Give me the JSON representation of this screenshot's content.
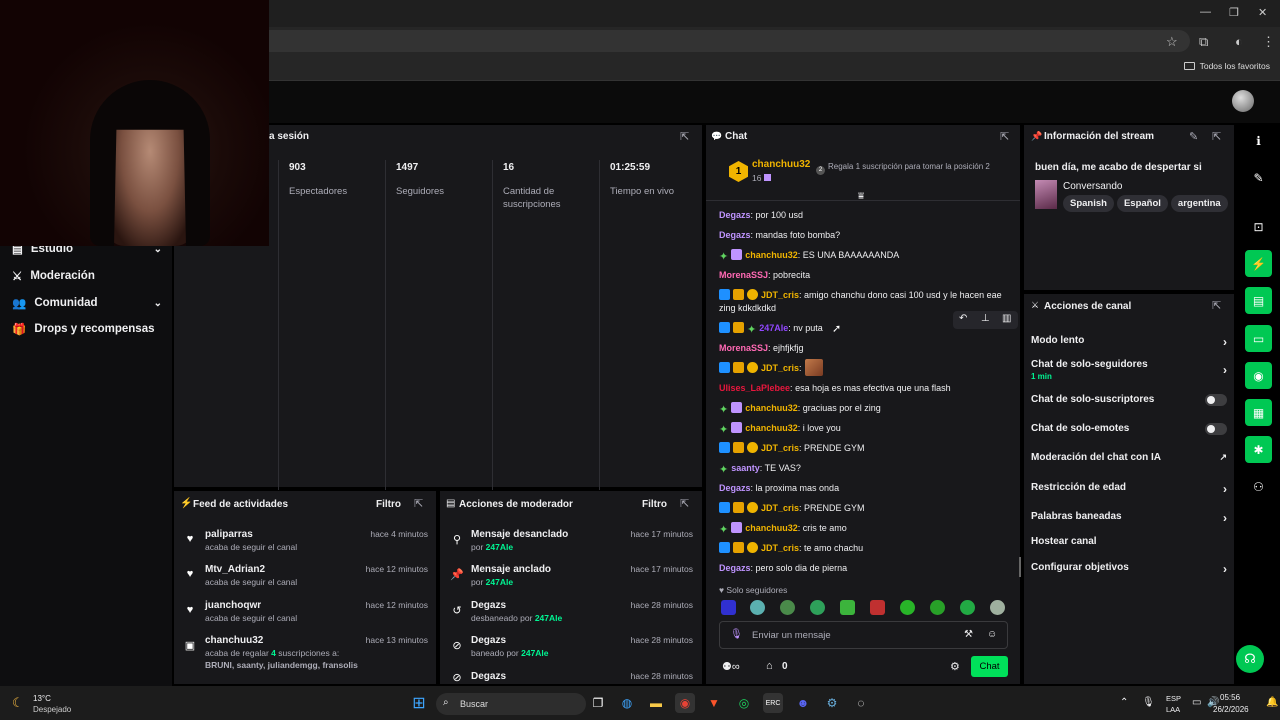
{
  "browser": {
    "favorites_label": "Todos los favoritos"
  },
  "sidebar": {
    "items": [
      {
        "label": "Estudio",
        "icon": "studio-icon",
        "chevron": true
      },
      {
        "label": "Moderación",
        "icon": "sword-icon",
        "chevron": false
      },
      {
        "label": "Comunidad",
        "icon": "people-icon",
        "chevron": true
      },
      {
        "label": "Drops y recompensas",
        "icon": "gift-icon",
        "chevron": false
      }
    ]
  },
  "session": {
    "title_visible": "a sesión",
    "stats": [
      {
        "value": "903",
        "label": "Espectadores"
      },
      {
        "value": "1497",
        "label": "Seguidores"
      },
      {
        "value": "16",
        "label": "Cantidad de suscripciones"
      },
      {
        "value": "01:25:59",
        "label": "Tiempo en vivo"
      }
    ]
  },
  "activity": {
    "title": "Feed de actividades",
    "filter_label": "Filtro",
    "items": [
      {
        "name": "paliparras",
        "sub": "acaba de seguir el canal",
        "time": "hace 4 minutos"
      },
      {
        "name": "Mtv_Adrian2",
        "sub": "acaba de seguir el canal",
        "time": "hace 12 minutos"
      },
      {
        "name": "juanchoqwr",
        "sub": "acaba de seguir el canal",
        "time": "hace 12 minutos"
      },
      {
        "name": "chanchuu32",
        "sub_prefix": "acaba de regalar ",
        "sub_count": "4",
        "sub_suffix": " suscripciones a:",
        "recipients": "BRUNI, saanty, juliandemgg, fransolis",
        "time": "hace 13 minutos"
      }
    ]
  },
  "mod_actions": {
    "title": "Acciones de moderador",
    "filter_label": "Filtro",
    "items": [
      {
        "name": "Mensaje desanclado",
        "by_prefix": "por ",
        "by": "247Ale",
        "time": "hace 17 minutos"
      },
      {
        "name": "Mensaje anclado",
        "by_prefix": "por ",
        "by": "247Ale",
        "time": "hace 17 minutos"
      },
      {
        "name": "Degazs",
        "by_prefix": "desbaneado por ",
        "by": "247Ale",
        "time": "hace 28 minutos"
      },
      {
        "name": "Degazs",
        "by_prefix": "baneado por ",
        "by": "247Ale",
        "time": "hace 28 minutos"
      },
      {
        "name": "Degazs",
        "by_prefix": "",
        "by": "",
        "time": "hace 28 minutos"
      }
    ]
  },
  "chat": {
    "title": "Chat",
    "gift_leader": {
      "rank": "1",
      "name": "chanchuu32",
      "count": "16",
      "cta": "Regala 1 suscripción para tomar la posición 2"
    },
    "messages": [
      {
        "user": "Degazs",
        "color": "#bf94ff",
        "badges": [],
        "text": "por 100 usd"
      },
      {
        "user": "Degazs",
        "color": "#bf94ff",
        "badges": [],
        "text": "mandas foto bomba?"
      },
      {
        "user": "chanchuu32",
        "color": "#f0b400",
        "badges": [
          "sparkle",
          "gift"
        ],
        "text": "ES UNA BAAAAAANDA"
      },
      {
        "user": "MorenaSSJ",
        "color": "#ff69b4",
        "badges": [],
        "text": "pobrecita"
      },
      {
        "user": "JDT_cris",
        "color": "#f0b400",
        "badges": [
          "blue",
          "crown",
          "gold"
        ],
        "text": "amigo chanchu dono casi 100 usd y le hacen eae zing kdkdkdkd"
      },
      {
        "user": "247Ale",
        "color": "#9147ff",
        "badges": [
          "blue",
          "crown",
          "sparkle"
        ],
        "text": "nv puta"
      },
      {
        "user": "MorenaSSJ",
        "color": "#ff69b4",
        "badges": [],
        "text": "ejhfjkfjg"
      },
      {
        "user": "JDT_cris",
        "color": "#f0b400",
        "badges": [
          "blue",
          "crown",
          "gold"
        ],
        "text": ""
      },
      {
        "user": "Ulises_LaPlebee",
        "color": "#e8173d",
        "badges": [],
        "text": "esa hoja es mas efectiva que una flash"
      },
      {
        "user": "chanchuu32",
        "color": "#f0b400",
        "badges": [
          "sparkle",
          "gift"
        ],
        "text": "graciuas por el zing"
      },
      {
        "user": "chanchuu32",
        "color": "#f0b400",
        "badges": [
          "sparkle",
          "gift"
        ],
        "text": "i love you"
      },
      {
        "user": "JDT_cris",
        "color": "#f0b400",
        "badges": [
          "blue",
          "crown",
          "gold"
        ],
        "text": "PRENDE GYM"
      },
      {
        "user": "saanty",
        "color": "#bf94ff",
        "badges": [
          "sparkle"
        ],
        "text": "TE VAS?"
      },
      {
        "user": "Degazs",
        "color": "#bf94ff",
        "badges": [],
        "text": "la proxima mas onda"
      },
      {
        "user": "JDT_cris",
        "color": "#f0b400",
        "badges": [
          "blue",
          "crown",
          "gold"
        ],
        "text": "PRENDE GYM"
      },
      {
        "user": "chanchuu32",
        "color": "#f0b400",
        "badges": [
          "sparkle",
          "gift"
        ],
        "text": "cris te amo"
      },
      {
        "user": "JDT_cris",
        "color": "#f0b400",
        "badges": [
          "blue",
          "crown",
          "gold"
        ],
        "text": "te amo chachu"
      },
      {
        "user": "Degazs",
        "color": "#bf94ff",
        "badges": [],
        "text": "pero solo dia de pierna"
      }
    ],
    "followers_only": "Solo seguidores",
    "input_placeholder": "Enviar un mensaje",
    "points": "0",
    "send_label": "Chat"
  },
  "stream_info": {
    "title": "Información del stream",
    "stream_title": "buen día, me acabo de despertar si",
    "category": "Conversando",
    "tags": [
      "Spanish",
      "Español",
      "argentina"
    ]
  },
  "channel_actions": {
    "title": "Acciones de canal",
    "items": [
      {
        "label": "Modo lento",
        "type": "chevron"
      },
      {
        "label": "Chat de solo-seguidores",
        "sub": "1 min",
        "type": "chevron"
      },
      {
        "label": "Chat de solo-suscriptores",
        "type": "toggle"
      },
      {
        "label": "Chat de solo-emotes",
        "type": "toggle"
      },
      {
        "label": "Moderación del chat con IA",
        "type": "external"
      },
      {
        "label": "Restricción de edad",
        "type": "chevron"
      },
      {
        "label": "Palabras baneadas",
        "type": "chevron"
      },
      {
        "label": "Hostear canal",
        "type": "none"
      },
      {
        "label": "Configurar objetivos",
        "type": "chevron"
      }
    ]
  },
  "taskbar": {
    "weather_temp": "13°C",
    "weather_desc": "Despejado",
    "search": "Buscar",
    "lang_top": "ESP",
    "lang_bottom": "LAA",
    "time": "05:56",
    "date": "26/2/2026"
  }
}
